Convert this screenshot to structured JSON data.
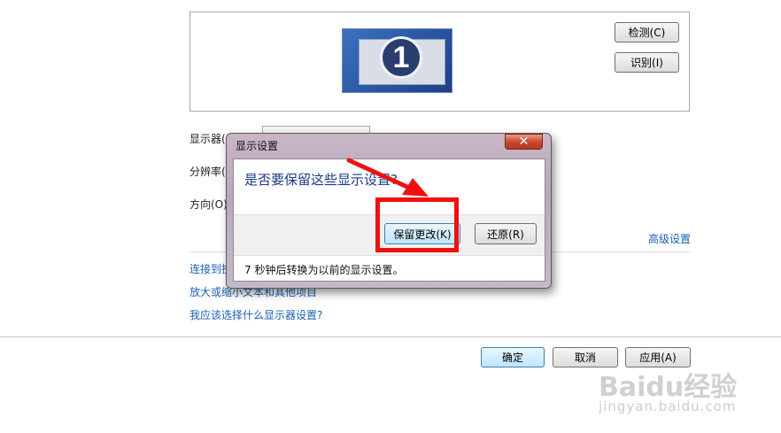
{
  "preview": {
    "monitor_number": "1",
    "detect_label": "检测(C)",
    "identify_label": "识别(I)"
  },
  "settings": {
    "display_label": "显示器(S",
    "resolution_label": "分辨率(R",
    "orientation_label": "方向(O):",
    "advanced_link": "高级设置"
  },
  "links": {
    "connect": "连接到投",
    "enlarge": "放大或缩小文本和其他项目",
    "which": "我应该选择什么显示器设置?"
  },
  "dialog": {
    "title": "显示设置",
    "close_glyph": "✕",
    "question": "是否要保留这些显示设置?",
    "keep_label": "保留更改(K)",
    "revert_label": "还原(R)",
    "footer": "7 秒钟后转换为以前的显示设置。"
  },
  "footer_buttons": {
    "ok_label": "确定",
    "cancel_label": "取消",
    "apply_label": "应用(A)"
  },
  "watermark": {
    "brand": "Baidu经验",
    "url": "jingyan.baidu.com"
  },
  "colors": {
    "link": "#1a5fb4",
    "highlight": "#ee1111",
    "arrow": "#ee1111"
  }
}
